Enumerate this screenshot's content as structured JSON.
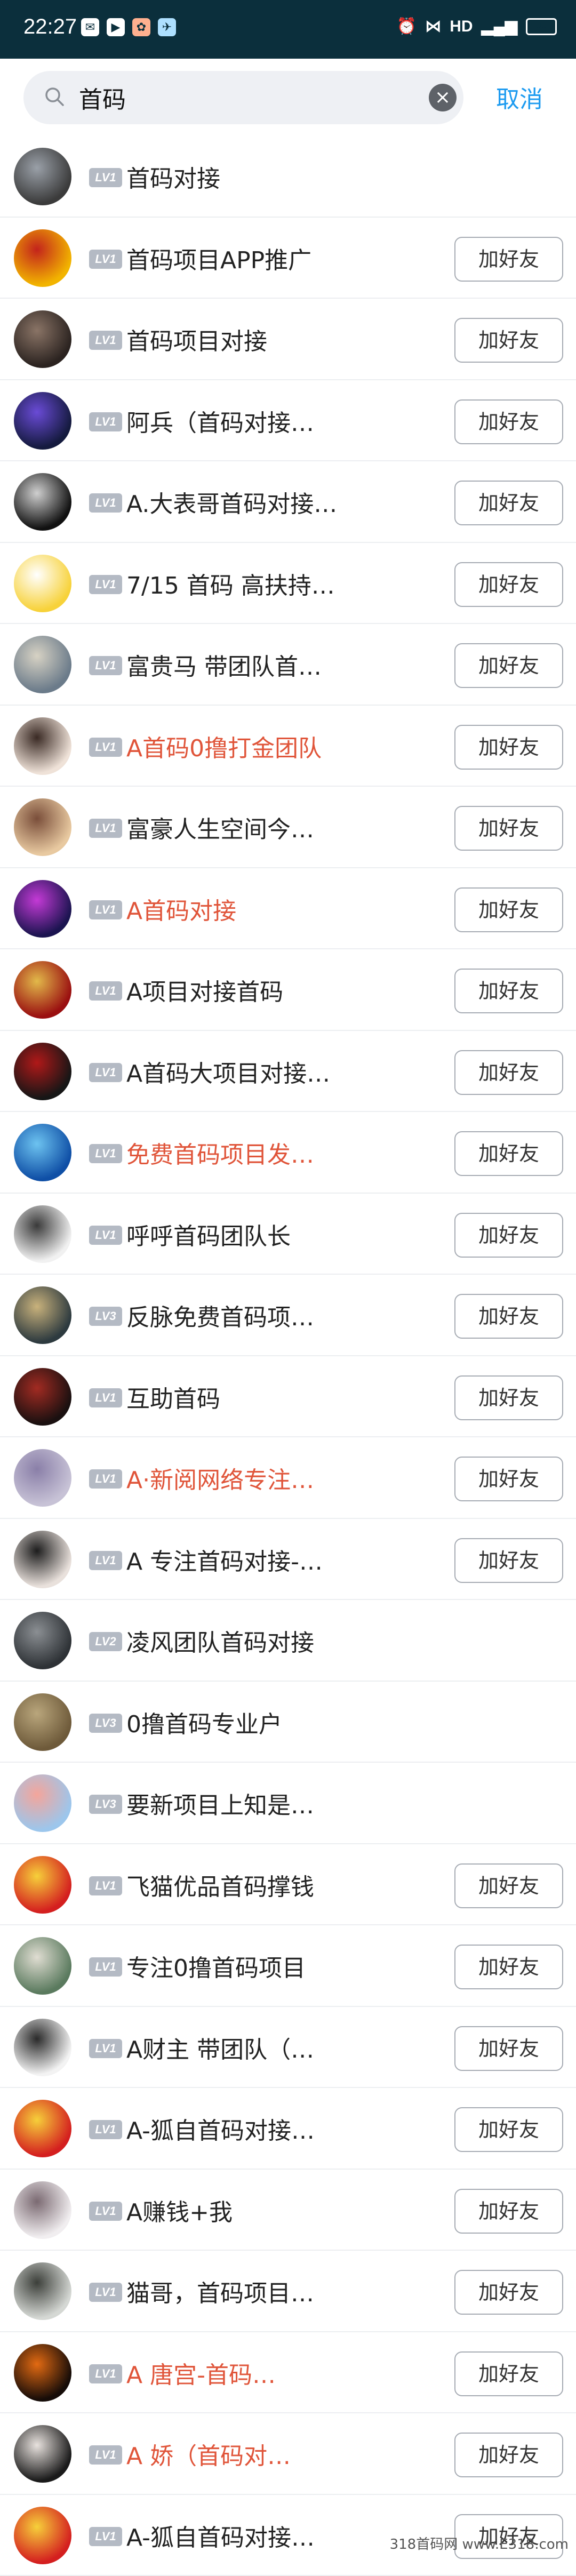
{
  "status_bar": {
    "time": "22:27",
    "right_text": "HD",
    "battery": "35"
  },
  "search": {
    "value": "首码",
    "cancel_label": "取消"
  },
  "colors": {
    "accent": "#1d9bf0",
    "highlight_name": "#e0553a",
    "status_bar_bg": "#0b2f3c"
  },
  "add_label": "加好友",
  "results": [
    {
      "name": "首码对接",
      "level": "LV1",
      "red": false,
      "has_button": false,
      "avatar": [
        "#3b3b3b",
        "#9aa0a8"
      ]
    },
    {
      "name": "首码项目APP推广",
      "level": "LV1",
      "red": false,
      "has_button": true,
      "avatar": [
        "#f2b400",
        "#c3231c"
      ]
    },
    {
      "name": "首码项目对接",
      "level": "LV1",
      "red": false,
      "has_button": true,
      "avatar": [
        "#2b2320",
        "#8a7466"
      ]
    },
    {
      "name": "阿兵（首码对接…",
      "level": "LV1",
      "red": false,
      "has_button": true,
      "avatar": [
        "#141a3e",
        "#6a4bd6"
      ]
    },
    {
      "name": "A.大表哥首码对接…",
      "level": "LV1",
      "red": false,
      "has_button": true,
      "avatar": [
        "#111111",
        "#cfcfcf"
      ]
    },
    {
      "name": "7/15 首码 高扶持…",
      "level": "LV1",
      "red": false,
      "has_button": true,
      "avatar": [
        "#f7d23a",
        "#ffffff"
      ]
    },
    {
      "name": "富贵马 带团队首…",
      "level": "LV1",
      "red": false,
      "has_button": true,
      "avatar": [
        "#6b7b8a",
        "#d7d2c4"
      ]
    },
    {
      "name": "A首码0撸打金团队",
      "level": "LV1",
      "red": true,
      "has_button": true,
      "avatar": [
        "#efe2d8",
        "#3a2a24"
      ]
    },
    {
      "name": "富豪人生空间今…",
      "level": "LV1",
      "red": false,
      "has_button": true,
      "avatar": [
        "#e8c9a0",
        "#7a4e3a"
      ]
    },
    {
      "name": "A首码对接",
      "level": "LV1",
      "red": true,
      "has_button": true,
      "avatar": [
        "#1b1450",
        "#c43ad6"
      ]
    },
    {
      "name": "A项目对接首码",
      "level": "LV1",
      "red": false,
      "has_button": true,
      "avatar": [
        "#9a0f10",
        "#e2b94a"
      ]
    },
    {
      "name": "A首码大项目对接…",
      "level": "LV1",
      "red": false,
      "has_button": true,
      "avatar": [
        "#161616",
        "#b01818"
      ]
    },
    {
      "name": "免费首码项目发…",
      "level": "LV1",
      "red": true,
      "has_button": true,
      "avatar": [
        "#0f4fa6",
        "#6dc3f0"
      ]
    },
    {
      "name": "呼呼首码团队长",
      "level": "LV1",
      "red": false,
      "has_button": true,
      "avatar": [
        "#f1f1f1",
        "#3a3a3a"
      ]
    },
    {
      "name": "反脉免费首码项…",
      "level": "LV3",
      "red": false,
      "has_button": true,
      "avatar": [
        "#2d3a3f",
        "#c9b27c"
      ]
    },
    {
      "name": "互助首码",
      "level": "LV1",
      "red": false,
      "has_button": true,
      "avatar": [
        "#1a1010",
        "#a22b22"
      ]
    },
    {
      "name": "A·新阅网络专注…",
      "level": "LV1",
      "red": true,
      "has_button": true,
      "avatar": [
        "#c7c2d6",
        "#8a7fa8"
      ]
    },
    {
      "name": "A 专注首码对接-…",
      "level": "LV1",
      "red": false,
      "has_button": true,
      "avatar": [
        "#e9e1dc",
        "#1d1d1d"
      ]
    },
    {
      "name": "凌风团队首码对接",
      "level": "LV2",
      "red": false,
      "has_button": false,
      "avatar": [
        "#2e3236",
        "#8b8f93"
      ]
    },
    {
      "name": "0撸首码专业户",
      "level": "LV3",
      "red": false,
      "has_button": false,
      "avatar": [
        "#6e5a3a",
        "#b9a67c"
      ]
    },
    {
      "name": "要新项目上知是…",
      "level": "LV3",
      "red": false,
      "has_button": false,
      "avatar": [
        "#9cc6ec",
        "#f4a59b"
      ]
    },
    {
      "name": "飞猫优品首码撑钱",
      "level": "LV1",
      "red": false,
      "has_button": true,
      "avatar": [
        "#d41f1f",
        "#f6d03a"
      ]
    },
    {
      "name": "专注0撸首码项目",
      "level": "LV1",
      "red": false,
      "has_button": true,
      "avatar": [
        "#5a7a5e",
        "#e0ddd2"
      ]
    },
    {
      "name": "A财主 带团队（…",
      "level": "LV1",
      "red": false,
      "has_button": true,
      "avatar": [
        "#f3f3f3",
        "#2a2a2a"
      ]
    },
    {
      "name": "A-狐自首码对接…",
      "level": "LV1",
      "red": false,
      "has_button": true,
      "avatar": [
        "#d41f1f",
        "#f6d03a"
      ]
    },
    {
      "name": "A赚钱+我",
      "level": "LV1",
      "red": false,
      "has_button": true,
      "avatar": [
        "#f1eef0",
        "#7b6a72"
      ]
    },
    {
      "name": "猫哥，首码项目…",
      "level": "LV1",
      "red": false,
      "has_button": true,
      "avatar": [
        "#d5d8d4",
        "#3c3f3a"
      ]
    },
    {
      "name": "A 唐宫-首码…",
      "level": "LV1",
      "red": true,
      "has_button": true,
      "avatar": [
        "#160c08",
        "#e26a12"
      ]
    },
    {
      "name": "A 娇（首码对…",
      "level": "LV1",
      "red": true,
      "has_button": true,
      "avatar": [
        "#1a1a1a",
        "#e8e2de"
      ]
    },
    {
      "name": "A-狐自首码对接…",
      "level": "LV1",
      "red": false,
      "has_button": true,
      "avatar": [
        "#d41f1f",
        "#f6d03a"
      ]
    }
  ],
  "watermark": "318首码网 www.E318.com"
}
